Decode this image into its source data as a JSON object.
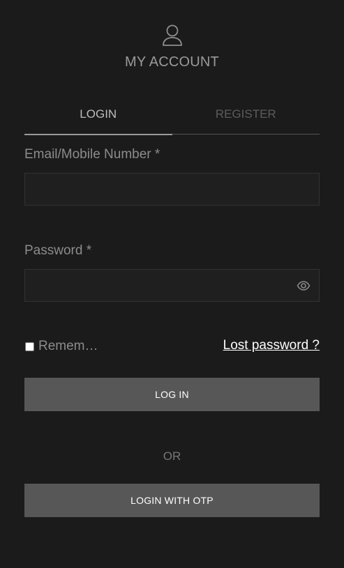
{
  "header": {
    "icon": "user-icon",
    "title": "MY ACCOUNT"
  },
  "tabs": [
    {
      "label": "LOGIN",
      "active": true
    },
    {
      "label": "REGISTER",
      "active": false
    }
  ],
  "form": {
    "email": {
      "label": "Email/Mobile Number *",
      "value": "",
      "placeholder": ""
    },
    "password": {
      "label": "Password *",
      "value": "",
      "placeholder": "",
      "toggle_icon": "eye-icon"
    },
    "remember": {
      "label": "Remem…",
      "checked": false
    },
    "lost_password_label": "Lost password ?",
    "login_button_label": "LOG IN",
    "or_label": "OR",
    "otp_button_label": "LOGIN WITH OTP"
  }
}
